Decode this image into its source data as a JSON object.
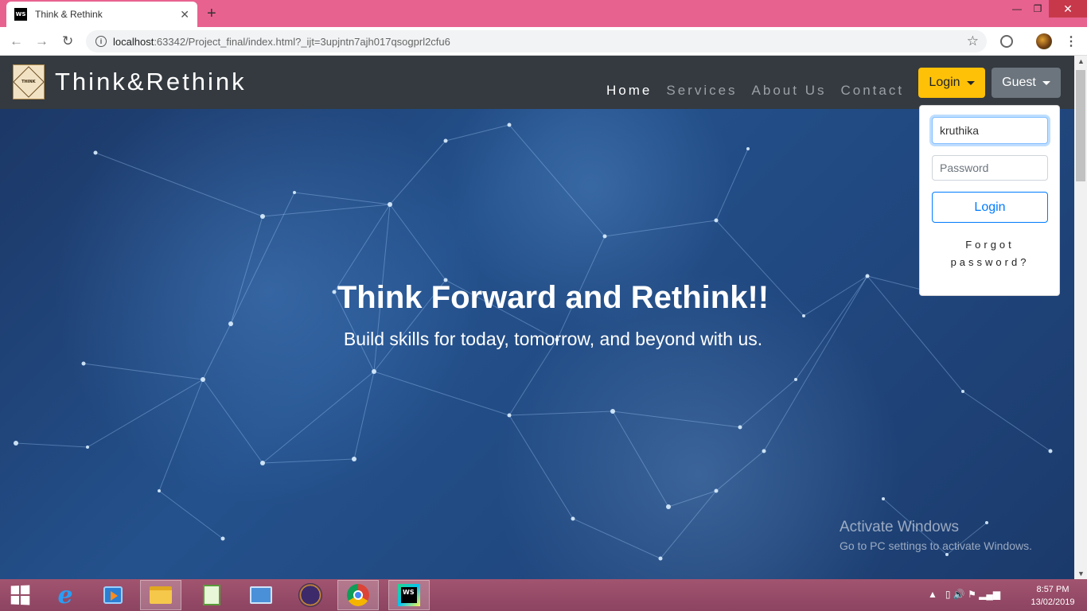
{
  "browser": {
    "tab_title": "Think & Rethink",
    "favicon_text": "WS",
    "tab_close": "✕",
    "new_tab": "+",
    "url_host": "localhost",
    "url_rest": ":63342/Project_final/index.html?_ijt=3upjntn7ajh017qsogprl2cfu6",
    "back": "←",
    "forward": "→",
    "reload": "↻",
    "star": "☆",
    "menu": "⋮",
    "info": "i",
    "minimize": "—",
    "maximize": "❐",
    "close": "✕"
  },
  "navbar": {
    "brand_name": "Think&Rethink",
    "logo_text": "THINK",
    "links": [
      {
        "label": "Home",
        "active": true
      },
      {
        "label": "Services"
      },
      {
        "label": "About Us"
      },
      {
        "label": "Contact"
      }
    ],
    "login_dropdown_label": "Login",
    "guest_dropdown_label": "Guest"
  },
  "login_form": {
    "username_value": "kruthika",
    "password_placeholder": "Password",
    "submit_label": "Login",
    "forgot_line1": "Forgot",
    "forgot_line2": "password?"
  },
  "hero": {
    "title": "Think Forward and Rethink!!",
    "subtitle": "Build skills for today, tomorrow, and beyond with us."
  },
  "watermark": {
    "title": "Activate Windows",
    "subtitle": "Go to PC settings to activate Windows."
  },
  "taskbar": {
    "ws_text": "WS",
    "ie_text": "e",
    "tray_arrow": "▲",
    "tray_icons": "▯ 🔊 ⚑ ▂▄▆",
    "time": "8:57 PM",
    "date": "13/02/2019"
  },
  "colors": {
    "tab_strip": "#e8628f",
    "navbar": "#343a40",
    "login_button": "#ffc107",
    "guest_button": "#6c757d",
    "primary": "#007bff"
  }
}
